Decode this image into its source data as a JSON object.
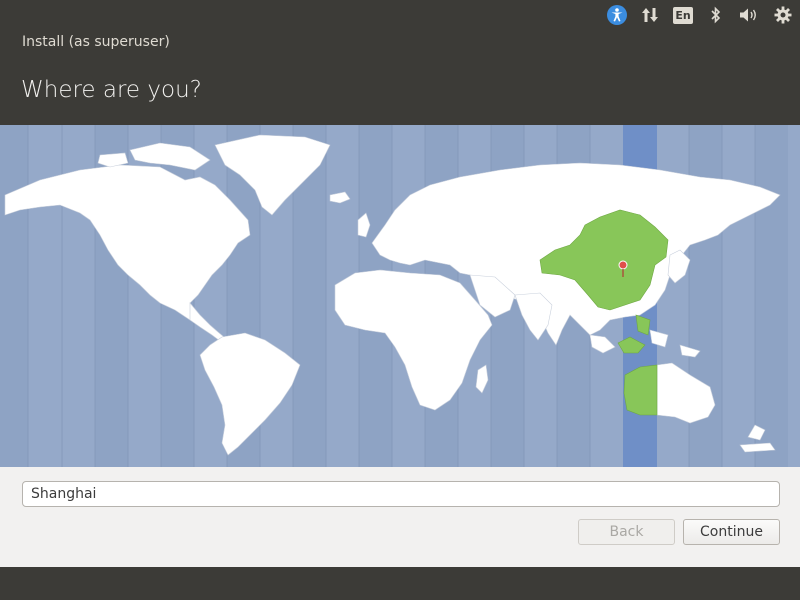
{
  "top_panel": {
    "icons": [
      "accessibility-icon",
      "network-updown-icon",
      "keyboard-language-icon",
      "bluetooth-icon",
      "volume-icon",
      "system-gear-icon"
    ],
    "language_indicator": "En"
  },
  "window": {
    "title": "Install (as superuser)",
    "page_title": "Where are you?"
  },
  "map": {
    "selected_timezone_highlight": "#6f8fc7",
    "selected_region_color": "#88c659",
    "land_color": "#ffffff",
    "ocean_color": "#95a9c9",
    "marker_color": "#e0504a"
  },
  "location": {
    "value": "Shanghai"
  },
  "buttons": {
    "back_label": "Back",
    "continue_label": "Continue"
  }
}
